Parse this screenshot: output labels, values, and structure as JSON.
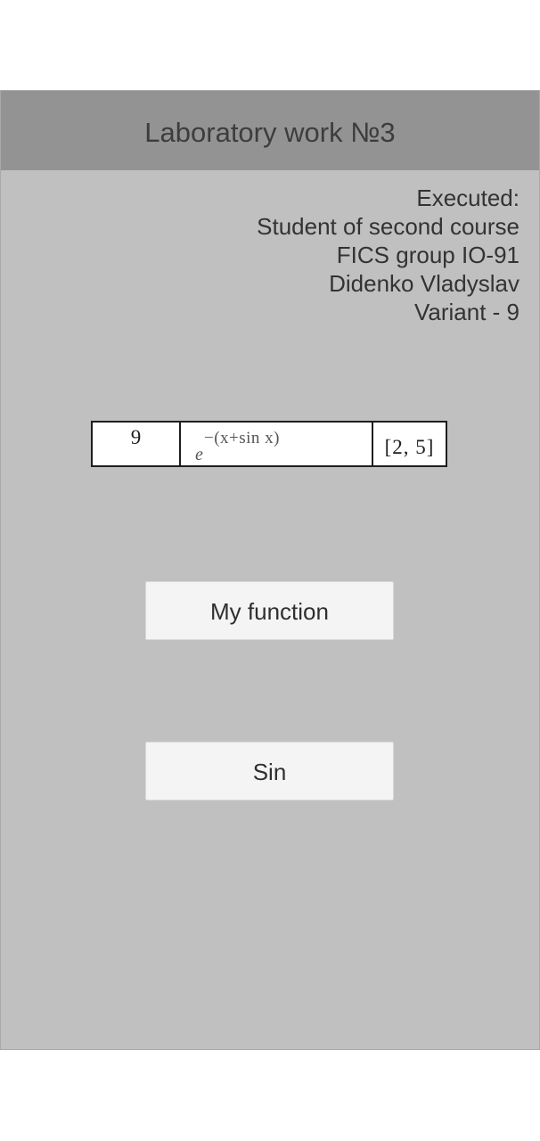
{
  "header": {
    "title": "Laboratory work №3"
  },
  "info": {
    "lines": [
      "Executed:",
      "Student of second course",
      "FICS group IO-91",
      "Didenko Vladyslav",
      "Variant - 9"
    ]
  },
  "variant_table": {
    "number": "9",
    "function_base": "e",
    "function_exponent": "−(x+sin x)",
    "interval": "[2, 5]"
  },
  "buttons": {
    "my_function": "My function",
    "sin": "Sin"
  },
  "colors": {
    "panel_background": "#c0c0c0",
    "title_bar": "#939393",
    "button_background": "#f4f4f4"
  }
}
